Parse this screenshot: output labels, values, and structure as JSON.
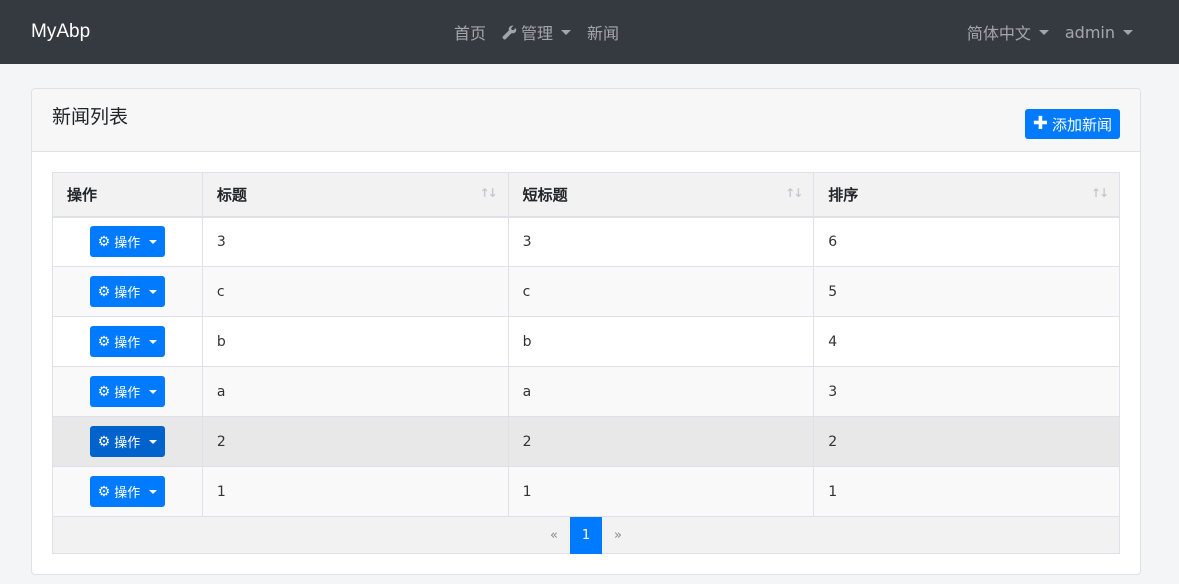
{
  "navbar": {
    "brand": "MyAbp",
    "links": [
      {
        "label": "首页"
      },
      {
        "label": "管理",
        "icon": "wrench-icon"
      },
      {
        "label": "新闻"
      }
    ],
    "language": "简体中文",
    "user": "admin"
  },
  "card": {
    "title": "新闻列表",
    "add_label": "添加新闻"
  },
  "table": {
    "headers": [
      "操作",
      "标题",
      "短标题",
      "排序"
    ],
    "op_label": "操作",
    "rows": [
      {
        "title": "3",
        "short": "3",
        "order": "6"
      },
      {
        "title": "c",
        "short": "c",
        "order": "5"
      },
      {
        "title": "b",
        "short": "b",
        "order": "4"
      },
      {
        "title": "a",
        "short": "a",
        "order": "3"
      },
      {
        "title": "2",
        "short": "2",
        "order": "2"
      },
      {
        "title": "1",
        "short": "1",
        "order": "1"
      }
    ]
  },
  "pagination": {
    "prev": "«",
    "current": "1",
    "next": "»"
  },
  "colors": {
    "navbar": "#343a40",
    "primary": "#007bff"
  }
}
